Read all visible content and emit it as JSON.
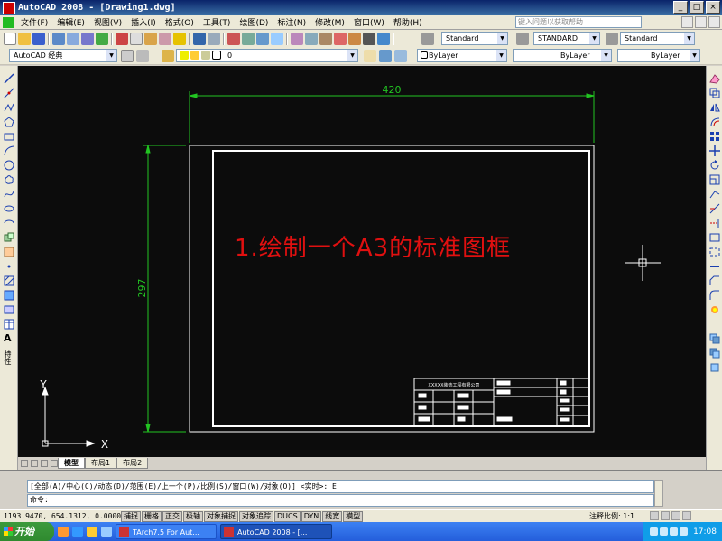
{
  "window": {
    "title": "AutoCAD 2008 - [Drawing1.dwg]",
    "controls": [
      "_",
      "□",
      "×"
    ]
  },
  "menubar": {
    "items": [
      "文件(F)",
      "编辑(E)",
      "视图(V)",
      "插入(I)",
      "格式(O)",
      "工具(T)",
      "绘图(D)",
      "标注(N)",
      "修改(M)",
      "窗口(W)",
      "帮助(H)"
    ],
    "help_search_placeholder": "键入问题以获取帮助"
  },
  "toolbar_styles": {
    "text_style": "Standard",
    "dim_style": "STANDARD",
    "table_style": "Standard"
  },
  "toolbar_layers": {
    "workspace": "AutoCAD 经典",
    "layer": "0",
    "color": "ByLayer",
    "linetype": "ByLayer",
    "lineweight": "ByLayer"
  },
  "drawing": {
    "dim_width": "420",
    "dim_height": "297",
    "headline": "1.绘制一个A3的标准图框",
    "ucs_y": "Y",
    "ucs_x": "X",
    "title_block_company": "XXXXX装饰工程有限公司"
  },
  "sidebar_label": "特性",
  "tabs": [
    "模型",
    "布局1",
    "布局2"
  ],
  "command": {
    "history": "[全部(A)/中心(C)/动态(D)/范围(E)/上一个(P)/比例(S)/窗口(W)/对象(O)] <实时>: E",
    "prompt": "命令:"
  },
  "statusbar": {
    "coords": "1193.9470, 654.1312, 0.0000",
    "toggles": [
      "捕捉",
      "栅格",
      "正交",
      "极轴",
      "对象捕捉",
      "对象追踪",
      "DUCS",
      "DYN",
      "线宽",
      "模型"
    ],
    "annotation_scale_label": "注释比例:",
    "annotation_scale_value": "1:1"
  },
  "taskbar": {
    "start": "开始",
    "tasks": [
      "TArch7.5 For Aut...",
      "AutoCAD 2008 - [..."
    ],
    "clock": "17:08"
  },
  "colors": {
    "canvas_bg": "#0c0c0c",
    "drawing_line": "#ffffff",
    "dimension": "#22c422",
    "headline": "#e01010"
  }
}
